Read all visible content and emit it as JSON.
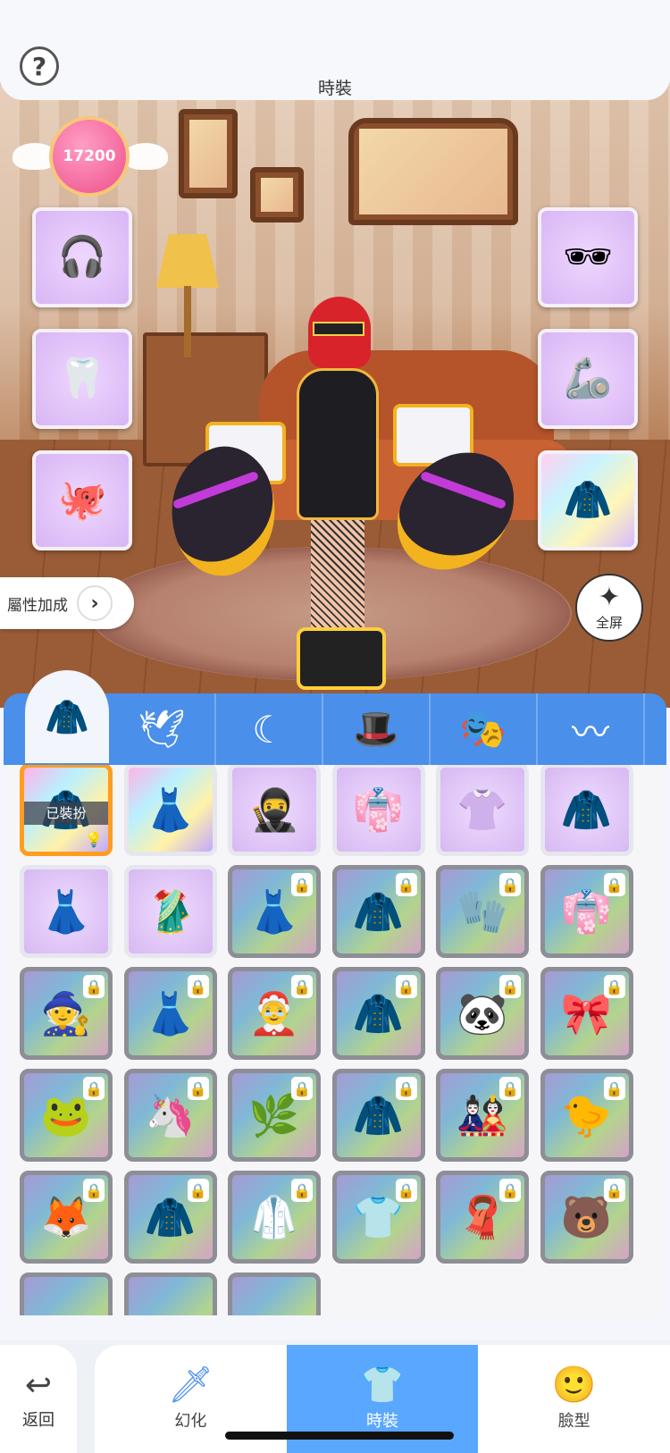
{
  "header": {
    "title": "時裝",
    "help_icon": "question-icon",
    "help_label": "?"
  },
  "currency": {
    "value": "17200"
  },
  "left_slots": [
    {
      "name": "headphone-ears",
      "icon": "🎧"
    },
    {
      "name": "fangs",
      "icon": "🦷"
    },
    {
      "name": "pet-blob",
      "icon": "🐙"
    }
  ],
  "right_slots": [
    {
      "name": "pixel-sunglasses",
      "icon": "🕶"
    },
    {
      "name": "tail-accessory",
      "icon": "🦾"
    },
    {
      "name": "jacket-outfit",
      "icon": "🧥"
    }
  ],
  "attr_button": {
    "label": "屬性加成",
    "arrow": "›"
  },
  "fullscreen": {
    "label": "全屏",
    "icon": "✦"
  },
  "tabs": [
    {
      "name": "outfit",
      "icon": "🧥",
      "active": true
    },
    {
      "name": "wings",
      "icon": "🕊"
    },
    {
      "name": "back-ornament",
      "icon": "☾"
    },
    {
      "name": "hat",
      "icon": "🎩"
    },
    {
      "name": "mask",
      "icon": "🎭"
    },
    {
      "name": "mustache",
      "icon": "〰"
    }
  ],
  "items": [
    {
      "icon": "🧥",
      "style": "rainbow",
      "locked": false,
      "selected": true,
      "equipped_label": "已裝扮",
      "bulb": "💡"
    },
    {
      "icon": "👗",
      "style": "rainbow",
      "locked": false
    },
    {
      "icon": "🥷",
      "style": "purple",
      "locked": false
    },
    {
      "icon": "👘",
      "style": "purple",
      "locked": false
    },
    {
      "icon": "👚",
      "style": "purple",
      "locked": false
    },
    {
      "icon": "🧥",
      "style": "purple",
      "locked": false
    },
    {
      "icon": "👗",
      "style": "purple",
      "locked": false
    },
    {
      "icon": "🥻",
      "style": "purple",
      "locked": false
    },
    {
      "icon": "👗",
      "style": "locked",
      "locked": true
    },
    {
      "icon": "🧥",
      "style": "locked",
      "locked": true
    },
    {
      "icon": "🧤",
      "style": "locked",
      "locked": true
    },
    {
      "icon": "👘",
      "style": "locked",
      "locked": true
    },
    {
      "icon": "🧙",
      "style": "locked",
      "locked": true
    },
    {
      "icon": "👗",
      "style": "locked",
      "locked": true
    },
    {
      "icon": "🤶",
      "style": "locked",
      "locked": true
    },
    {
      "icon": "🧥",
      "style": "locked",
      "locked": true
    },
    {
      "icon": "🐼",
      "style": "locked",
      "locked": true
    },
    {
      "icon": "🎀",
      "style": "locked",
      "locked": true
    },
    {
      "icon": "🐸",
      "style": "locked",
      "locked": true
    },
    {
      "icon": "🦄",
      "style": "locked",
      "locked": true
    },
    {
      "icon": "🌿",
      "style": "locked",
      "locked": true
    },
    {
      "icon": "🧥",
      "style": "locked",
      "locked": true
    },
    {
      "icon": "🎎",
      "style": "locked",
      "locked": true
    },
    {
      "icon": "🐤",
      "style": "locked",
      "locked": true
    },
    {
      "icon": "🦊",
      "style": "locked",
      "locked": true
    },
    {
      "icon": "🧥",
      "style": "locked",
      "locked": true
    },
    {
      "icon": "🥼",
      "style": "locked",
      "locked": true
    },
    {
      "icon": "👕",
      "style": "locked",
      "locked": true
    },
    {
      "icon": "🧣",
      "style": "locked",
      "locked": true
    },
    {
      "icon": "🐻",
      "style": "locked",
      "locked": true
    }
  ],
  "lock_icon": "🔒",
  "back": {
    "label": "返回",
    "icon": "↩"
  },
  "nav": [
    {
      "label": "幻化",
      "icon": "🗡",
      "active": false
    },
    {
      "label": "時裝",
      "icon": "👕",
      "active": true
    },
    {
      "label": "臉型",
      "icon": "🙂",
      "active": false
    }
  ]
}
